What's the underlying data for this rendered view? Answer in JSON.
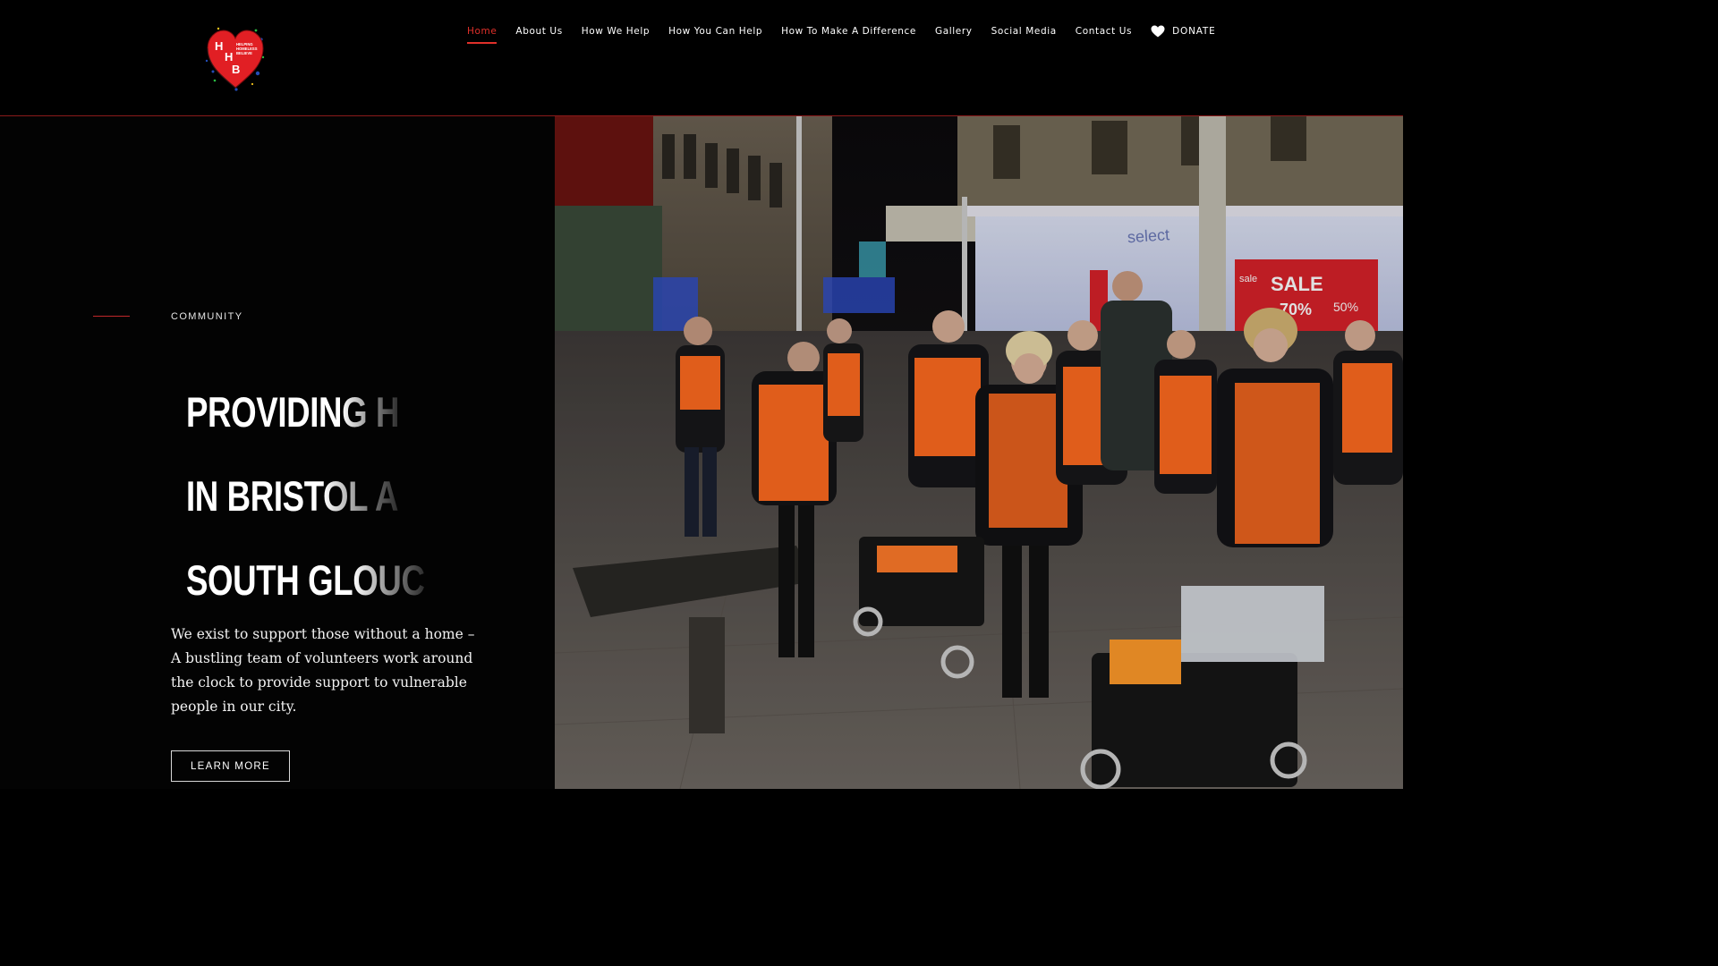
{
  "site": {
    "logo_name": "Helping Homeless Bristol logo",
    "logo_letters": [
      "H",
      "H",
      "B"
    ],
    "logo_text": "HELPING HOMELESS BELIEVE"
  },
  "nav": {
    "items": [
      {
        "label": "Home",
        "active": true
      },
      {
        "label": "About Us",
        "active": false
      },
      {
        "label": "How We Help",
        "active": false
      },
      {
        "label": "How You Can Help",
        "active": false
      },
      {
        "label": "How To Make A Difference",
        "active": false
      },
      {
        "label": "Gallery",
        "active": false
      },
      {
        "label": "Social Media",
        "active": false
      },
      {
        "label": "Contact Us",
        "active": false
      }
    ],
    "donate_label": "DONATE",
    "donate_icon": "heart-icon"
  },
  "hero": {
    "eyebrow": "COMMUNITY",
    "headline_lines": [
      {
        "solid": "PROVIDIN",
        "faded": "G H"
      },
      {
        "solid": "IN BRIST",
        "faded": "OL A"
      },
      {
        "solid": "SOUTH GL",
        "faded": "OUC"
      }
    ],
    "body": "We exist to support those without a home – A bustling team of volunteers work around the clock to provide support to vulnerable people in our city.",
    "cta_label": "LEARN MORE",
    "photo_alt": "Volunteers in high-visibility vests standing with trolleys on a city street at night",
    "photo_signage": {
      "shop_sign": "select",
      "sale_sign": "SALE",
      "sale_small": "sale",
      "discount": "70%",
      "discount_small": "50%"
    }
  },
  "colors": {
    "background": "#000000",
    "accent": "#e0302a",
    "text": "#ffffff",
    "hiviz": "#ff6a1f"
  }
}
